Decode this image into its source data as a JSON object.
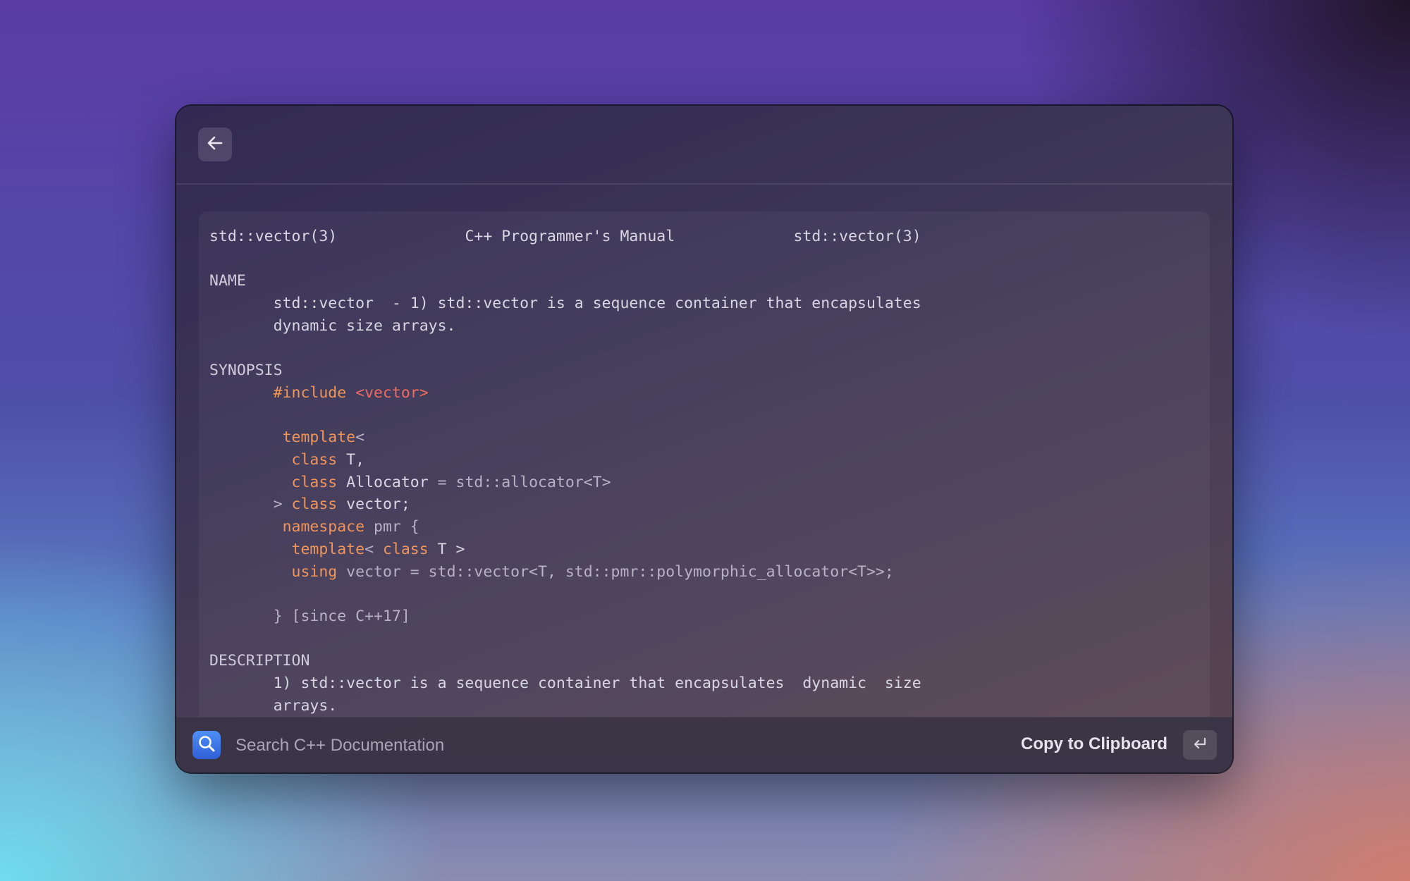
{
  "header": {
    "back_icon": "arrow-left-icon"
  },
  "doc": {
    "title_left": "std::vector(3)",
    "title_center": "C++ Programmer's Manual",
    "title_right": "std::vector(3)",
    "name_heading": "NAME",
    "name_line1": "std::vector  - 1) std::vector is a sequence container that encapsulates",
    "name_line2": "dynamic size arrays.",
    "synopsis_heading": "SYNOPSIS",
    "include_kw": "#include",
    "include_hdr": "<vector>",
    "tpl_kw": "template",
    "tpl_open": "<",
    "class_kw": "class",
    "class_t": " T,",
    "alloc_name": " Allocator",
    "alloc_rest": " = std::allocator<T>",
    "gt": "> ",
    "vector_decl": " vector;",
    "ns_kw": "namespace",
    "ns_rest": " pmr {",
    "tpl2_open": "< ",
    "tpl2_rest": " T >",
    "using_kw": "using",
    "using_rest": " vector = std::vector<T, std::pmr::polymorphic_allocator<T>>;",
    "ns_close": "} [since C++17]",
    "description_heading": "DESCRIPTION",
    "desc_line1": "1) std::vector is a sequence container that encapsulates  dynamic  size",
    "desc_line2": "arrays."
  },
  "footer": {
    "search_placeholder": "Search C++ Documentation",
    "search_value": "",
    "action_label": "Copy to Clipboard",
    "enter_icon": "return-key-icon",
    "search_icon": "magnifier-icon"
  },
  "colors": {
    "keyword": "#f0955a",
    "header_string": "#ee6a63",
    "search_icon_bg": "#3b74e8"
  }
}
